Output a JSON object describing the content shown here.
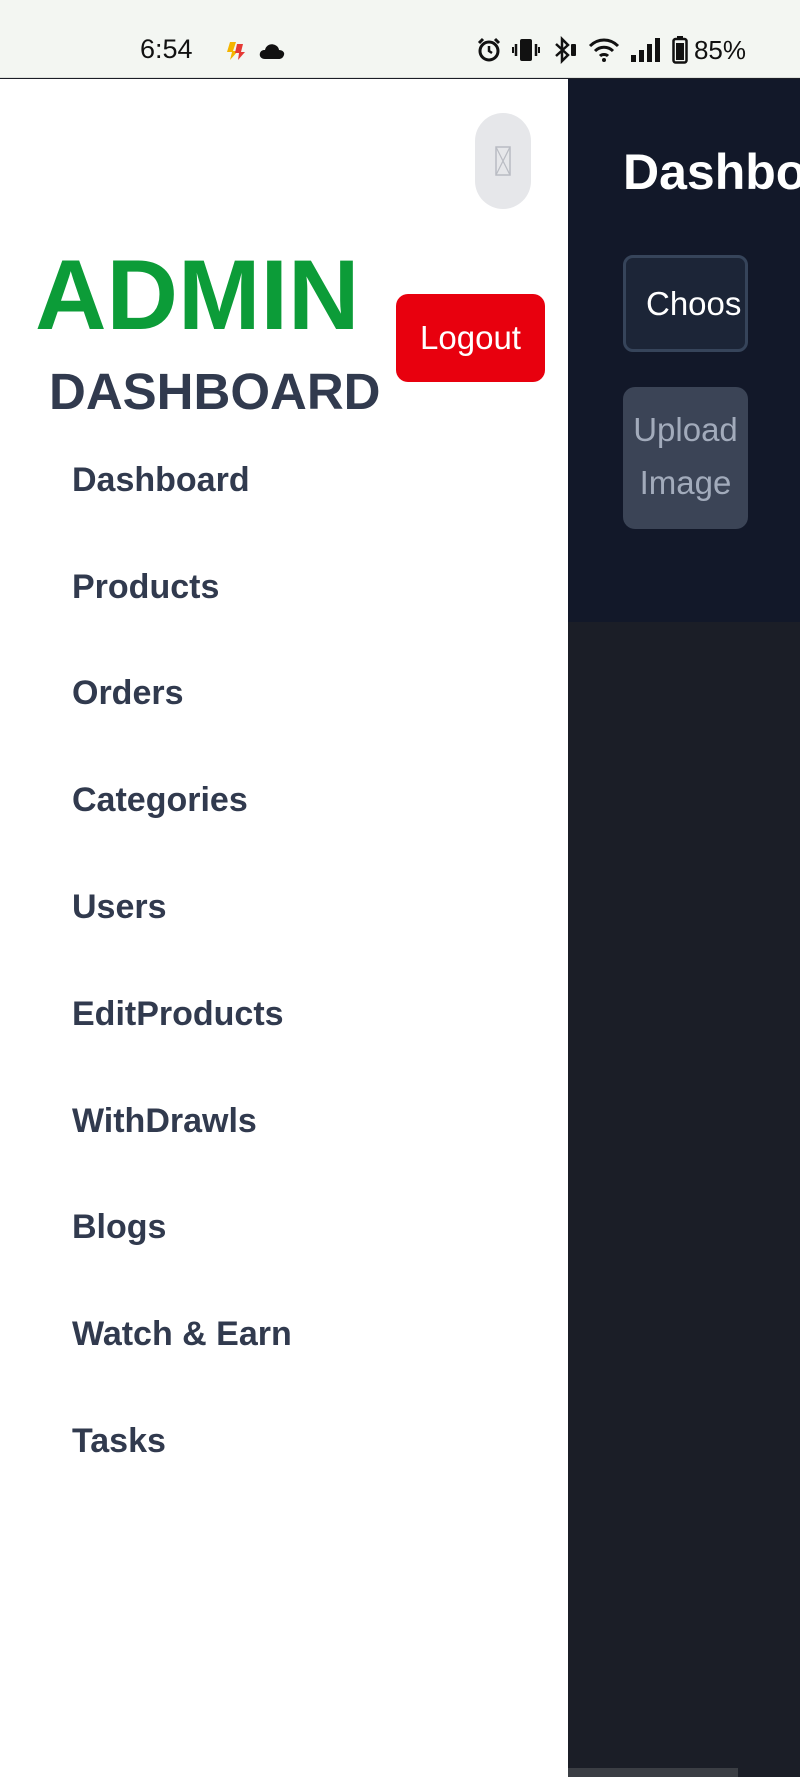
{
  "status_bar": {
    "time": "6:54",
    "battery": "85%",
    "icons": [
      "notification-app-icon",
      "cloud-icon",
      "alarm-icon",
      "vibrate-icon",
      "bluetooth-icon",
      "wifi-icon",
      "signal-icon",
      "battery-icon"
    ]
  },
  "sidebar": {
    "title": "ADMIN",
    "subtitle": "DASHBOARD",
    "logout_label": "Logout",
    "close_icon": "close-icon",
    "items": [
      {
        "label": "Dashboard"
      },
      {
        "label": "Products"
      },
      {
        "label": "Orders"
      },
      {
        "label": "Categories"
      },
      {
        "label": "Users"
      },
      {
        "label": "EditProducts"
      },
      {
        "label": "WithDrawls"
      },
      {
        "label": "Blogs"
      },
      {
        "label": "Watch & Earn"
      },
      {
        "label": "Tasks"
      }
    ]
  },
  "main": {
    "title": "Dashbo",
    "choose_file_label": "Choos",
    "upload_label_line1": "Upload",
    "upload_label_line2": "Image"
  },
  "colors": {
    "admin_green": "#0c9c38",
    "logout_red": "#e8000e",
    "sidebar_text": "#313a4e",
    "main_bg": "#121829"
  }
}
